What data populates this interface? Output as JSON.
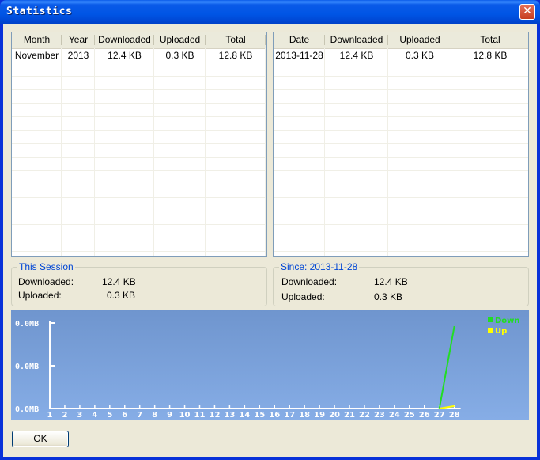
{
  "window": {
    "title": "Statistics",
    "close_symbol": "✕"
  },
  "monthly_table": {
    "columns": [
      "Month",
      "Year",
      "Downloaded",
      "Uploaded",
      "Total"
    ],
    "rows": [
      [
        "November",
        "2013",
        "12.4 KB",
        "0.3 KB",
        "12.8 KB"
      ]
    ]
  },
  "daily_table": {
    "columns": [
      "Date",
      "Downloaded",
      "Uploaded",
      "Total"
    ],
    "rows": [
      [
        "2013-11-28",
        "12.4 KB",
        "0.3 KB",
        "12.8 KB"
      ]
    ]
  },
  "session": {
    "title": "This Session",
    "downloaded_label": "Downloaded:",
    "downloaded_value": "12.4  KB",
    "uploaded_label": "Uploaded:",
    "uploaded_value": "0.3  KB"
  },
  "since": {
    "title": "Since: 2013-11-28",
    "downloaded_label": "Downloaded:",
    "downloaded_value": "12.4 KB",
    "uploaded_label": "Uploaded:",
    "uploaded_value": "0.3 KB"
  },
  "chart_data": {
    "type": "line",
    "x": [
      1,
      2,
      3,
      4,
      5,
      6,
      7,
      8,
      9,
      10,
      11,
      12,
      13,
      14,
      15,
      16,
      17,
      18,
      19,
      20,
      21,
      22,
      23,
      24,
      25,
      26,
      27,
      28
    ],
    "y_tick_labels": [
      "0.0MB",
      "0.0MB",
      "0.0MB"
    ],
    "series": [
      {
        "name": "Down",
        "color": "#22dd22",
        "values": [
          0,
          0,
          0,
          0,
          0,
          0,
          0,
          0,
          0,
          0,
          0,
          0,
          0,
          0,
          0,
          0,
          0,
          0,
          0,
          0,
          0,
          0,
          0,
          0,
          0,
          0,
          0,
          1.0
        ]
      },
      {
        "name": "Up",
        "color": "#ffff00",
        "values": [
          0,
          0,
          0,
          0,
          0,
          0,
          0,
          0,
          0,
          0,
          0,
          0,
          0,
          0,
          0,
          0,
          0,
          0,
          0,
          0,
          0,
          0,
          0,
          0,
          0,
          0,
          0,
          0.03
        ]
      }
    ],
    "legend_position": "top-right",
    "background": "#7aa0da"
  },
  "buttons": {
    "ok": "OK"
  }
}
